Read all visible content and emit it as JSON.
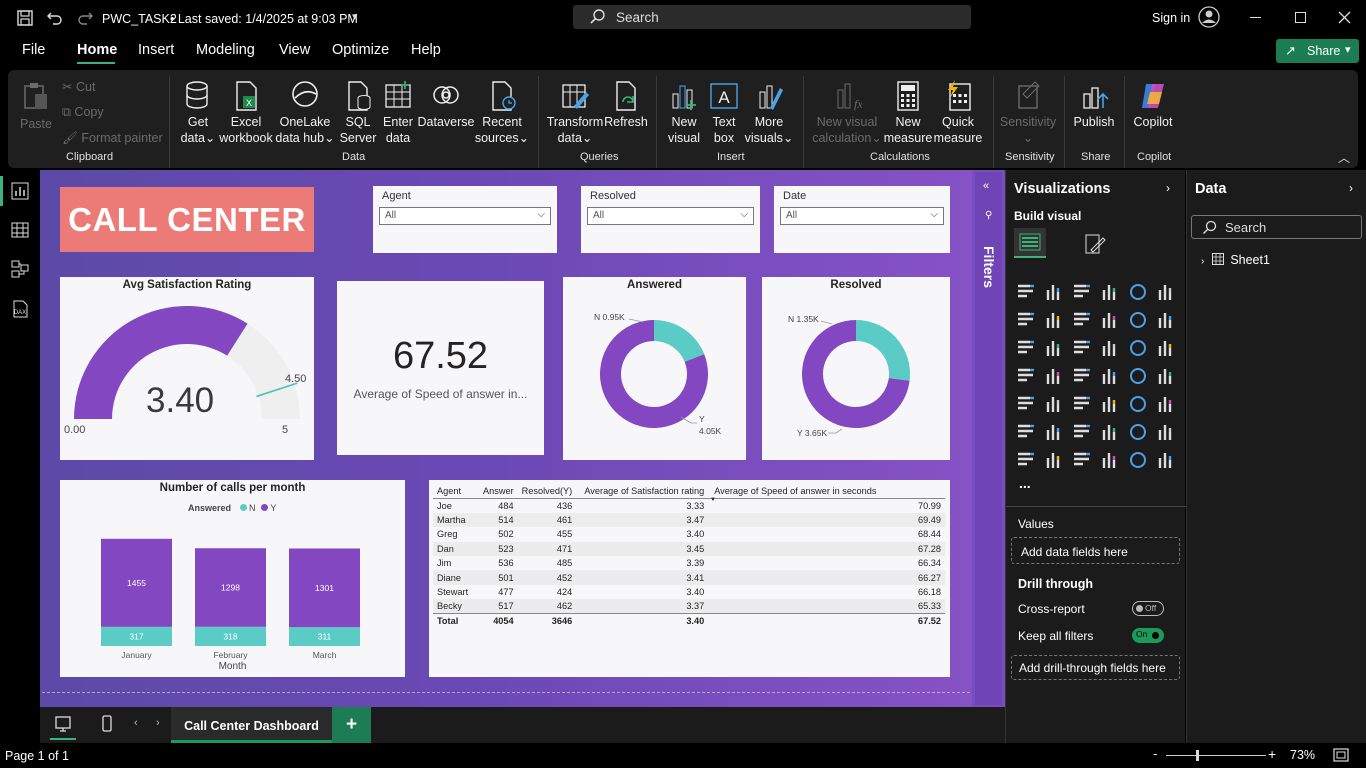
{
  "titlebar": {
    "doc": "PWC_TASK2",
    "saved": "• Last saved: 1/4/2025 at 9:03 PM",
    "search": "Search",
    "signin": "Sign in"
  },
  "menu": {
    "file": "File",
    "home": "Home",
    "insert": "Insert",
    "modeling": "Modeling",
    "view": "View",
    "optimize": "Optimize",
    "help": "Help",
    "share": "Share"
  },
  "ribbon": {
    "paste": "Paste",
    "cut": "Cut",
    "copy": "Copy",
    "format_painter": "Format painter",
    "clipboard": "Clipboard",
    "get_data": [
      "Get",
      "data"
    ],
    "excel": [
      "Excel",
      "workbook"
    ],
    "onelake": [
      "OneLake",
      "data hub"
    ],
    "sql": [
      "SQL",
      "Server"
    ],
    "enter": [
      "Enter",
      "data"
    ],
    "dataverse": "Dataverse",
    "recent": [
      "Recent",
      "sources"
    ],
    "data": "Data",
    "transform": [
      "Transform",
      "data"
    ],
    "refresh": "Refresh",
    "queries": "Queries",
    "new_visual": [
      "New",
      "visual"
    ],
    "text_box": [
      "Text",
      "box"
    ],
    "more_visuals": [
      "More",
      "visuals"
    ],
    "insert": "Insert",
    "new_visual_calc": [
      "New visual",
      "calculation"
    ],
    "new_measure": [
      "New",
      "measure"
    ],
    "quick_measure": [
      "Quick",
      "measure"
    ],
    "calculations": "Calculations",
    "sensitivity": "Sensitivity",
    "sensitivity_grp": "Sensitivity",
    "publish": "Publish",
    "share_grp": "Share",
    "copilot": "Copilot",
    "copilot_grp": "Copilot"
  },
  "report": {
    "title": "CALL CENTER",
    "slicers": [
      {
        "label": "Agent",
        "value": "All"
      },
      {
        "label": "Resolved",
        "value": "All"
      },
      {
        "label": "Date",
        "value": "All"
      }
    ],
    "gauge": {
      "title": "Avg Satisfaction Rating",
      "value": "3.40",
      "min": "0.00",
      "max": "5",
      "target": "4.50"
    },
    "kpi": {
      "value": "67.52",
      "label": "Average of Speed of answer in..."
    },
    "answered": {
      "title": "Answered",
      "n_label": "N 0.95K",
      "y_label_1": "Y",
      "y_label_2": "4.05K"
    },
    "resolved": {
      "title": "Resolved",
      "n_label": "N 1.35K",
      "y_label": "Y 3.65K"
    },
    "month_chart": {
      "title": "Number of calls per month",
      "legend_title": "Answered",
      "legend_n": "N",
      "legend_y": "Y",
      "xlabel": "Month"
    },
    "table": {
      "headers": [
        "Agent",
        "Answer",
        "Resolved(Y)",
        "Average of Satisfaction rating",
        "Average of Speed of answer in seconds"
      ],
      "rows": [
        [
          "Joe",
          "484",
          "436",
          "3.33",
          "70.99"
        ],
        [
          "Martha",
          "514",
          "461",
          "3.47",
          "69.49"
        ],
        [
          "Greg",
          "502",
          "455",
          "3.40",
          "68.44"
        ],
        [
          "Dan",
          "523",
          "471",
          "3.45",
          "67.28"
        ],
        [
          "Jim",
          "536",
          "485",
          "3.39",
          "66.34"
        ],
        [
          "Diane",
          "501",
          "452",
          "3.41",
          "66.27"
        ],
        [
          "Stewart",
          "477",
          "424",
          "3.40",
          "66.18"
        ],
        [
          "Becky",
          "517",
          "462",
          "3.37",
          "65.33"
        ]
      ],
      "total": [
        "Total",
        "4054",
        "3646",
        "3.40",
        "67.52"
      ]
    }
  },
  "chart_data": [
    {
      "type": "bar",
      "title": "Number of calls per month",
      "categories": [
        "January",
        "February",
        "March"
      ],
      "series": [
        {
          "name": "N",
          "values": [
            317,
            318,
            311
          ]
        },
        {
          "name": "Y",
          "values": [
            1455,
            1298,
            1301
          ]
        }
      ],
      "xlabel": "Month",
      "stacked": true,
      "colors": {
        "N": "#5bcbc5",
        "Y": "#8347c1"
      },
      "legend": "top"
    },
    {
      "type": "pie",
      "title": "Answered",
      "categories": [
        "N",
        "Y"
      ],
      "values": [
        950,
        4050
      ],
      "colors": [
        "#5bcbc5",
        "#8347c1"
      ]
    },
    {
      "type": "pie",
      "title": "Resolved",
      "categories": [
        "N",
        "Y"
      ],
      "values": [
        1350,
        3650
      ],
      "colors": [
        "#5bcbc5",
        "#8347c1"
      ]
    },
    {
      "type": "gauge",
      "title": "Avg Satisfaction Rating",
      "value": 3.4,
      "min": 0,
      "max": 5,
      "target": 4.5
    }
  ],
  "filters_label": "Filters",
  "viz": {
    "title": "Visualizations",
    "build": "Build visual",
    "values": "Values",
    "add_data": "Add data fields here",
    "drill": "Drill through",
    "cross": "Cross-report",
    "cross_state": "Off",
    "keep": "Keep all filters",
    "keep_state": "On",
    "add_drill": "Add drill-through fields here",
    "more": "..."
  },
  "data_pane": {
    "title": "Data",
    "search": "Search",
    "sheet": "Sheet1"
  },
  "tabs": {
    "page": "Call Center Dashboard",
    "add": "+"
  },
  "status": {
    "page": "Page 1 of 1",
    "zoom": "73%"
  },
  "colors": {
    "accent": "#8347c1",
    "teal": "#5bcbc5",
    "title_bg": "#ec7b78",
    "share": "#1c7d55"
  }
}
